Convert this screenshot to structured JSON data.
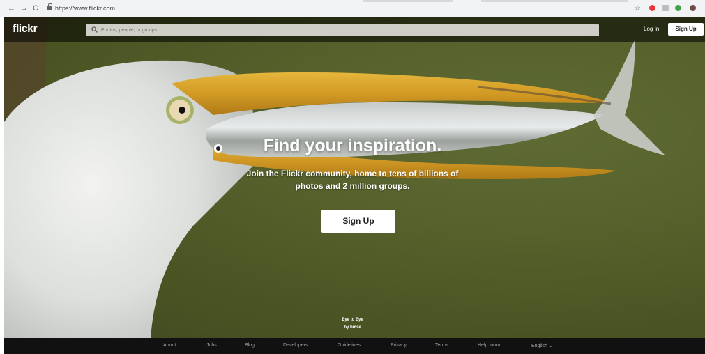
{
  "browser": {
    "url": "https://www.flickr.com",
    "nav_back": "←",
    "nav_forward": "→",
    "nav_reload": "C",
    "star": "☆",
    "menu": "⋮"
  },
  "topbar": {
    "logo": "flickr",
    "search_placeholder": "Photos, people, or groups",
    "login": "Log In",
    "signup": "Sign Up"
  },
  "hero": {
    "headline": "Find your inspiration.",
    "subline_1": "Join the Flickr community, home to tens of billions of",
    "subline_2": "photos and 2 million groups.",
    "signup": "Sign Up",
    "credit_title": "Eye to Eye",
    "credit_author": "by bmse"
  },
  "footer": {
    "links": [
      "About",
      "Jobs",
      "Blog",
      "Developers",
      "Guidelines",
      "Privacy",
      "Terms",
      "Help forum",
      "English ⌄"
    ]
  },
  "colors": {
    "topbar_bg": "#000000",
    "footer_bg": "#111111",
    "accent_white": "#ffffff"
  }
}
